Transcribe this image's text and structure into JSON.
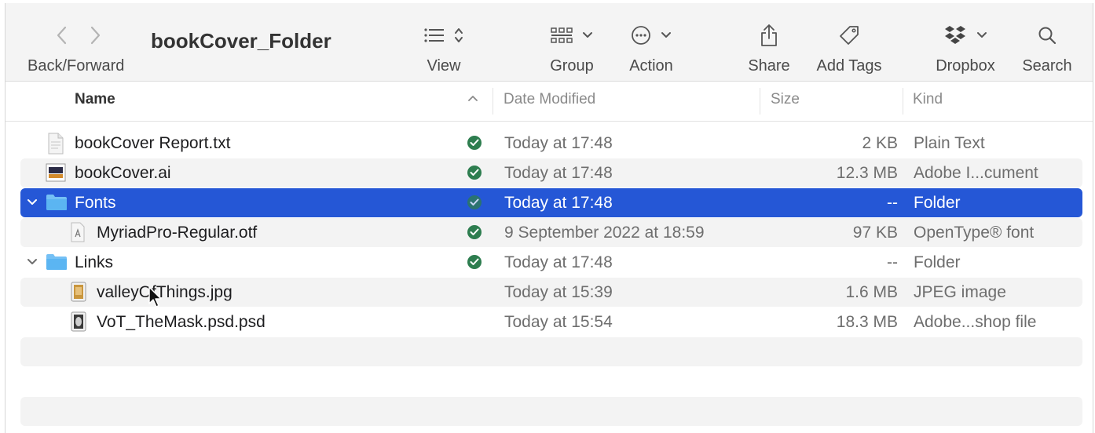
{
  "window": {
    "title": "bookCover_Folder"
  },
  "toolbar": {
    "back_forward_label": "Back/Forward",
    "view_label": "View",
    "group_label": "Group",
    "action_label": "Action",
    "share_label": "Share",
    "add_tags_label": "Add Tags",
    "dropbox_label": "Dropbox",
    "search_label": "Search"
  },
  "columns": {
    "name": "Name",
    "date_modified": "Date Modified",
    "size": "Size",
    "kind": "Kind"
  },
  "colors": {
    "selection": "#2557d6",
    "synced_status": "#2d7d4f",
    "folder": "#5bb5f2"
  },
  "rows": [
    {
      "name": "bookCover Report.txt",
      "date": "Today at 17:48",
      "size": "2 KB",
      "kind": "Plain Text",
      "icon": "text-file-icon",
      "synced": true
    },
    {
      "name": "bookCover.ai",
      "date": "Today at 17:48",
      "size": "12.3 MB",
      "kind": "Adobe I...cument",
      "icon": "illustrator-file-icon",
      "synced": true
    },
    {
      "name": "Fonts",
      "date": "Today at 17:48",
      "size": "--",
      "kind": "Folder",
      "icon": "folder-icon",
      "synced": true,
      "expanded": true,
      "selected": true
    },
    {
      "name": "MyriadPro-Regular.otf",
      "date": "9 September 2022 at 18:59",
      "size": "97 KB",
      "kind": "OpenType® font",
      "icon": "font-file-icon",
      "synced": true
    },
    {
      "name": "Links",
      "date": "Today at 17:48",
      "size": "--",
      "kind": "Folder",
      "icon": "folder-icon",
      "synced": true,
      "expanded": true
    },
    {
      "name": "valleyOfThings.jpg",
      "date": "Today at 15:39",
      "size": "1.6 MB",
      "kind": "JPEG image",
      "icon": "jpeg-file-icon",
      "synced": false
    },
    {
      "name": "VoT_TheMask.psd.psd",
      "date": "Today at 15:54",
      "size": "18.3 MB",
      "kind": "Adobe...shop file",
      "icon": "photoshop-file-icon",
      "synced": false
    }
  ]
}
